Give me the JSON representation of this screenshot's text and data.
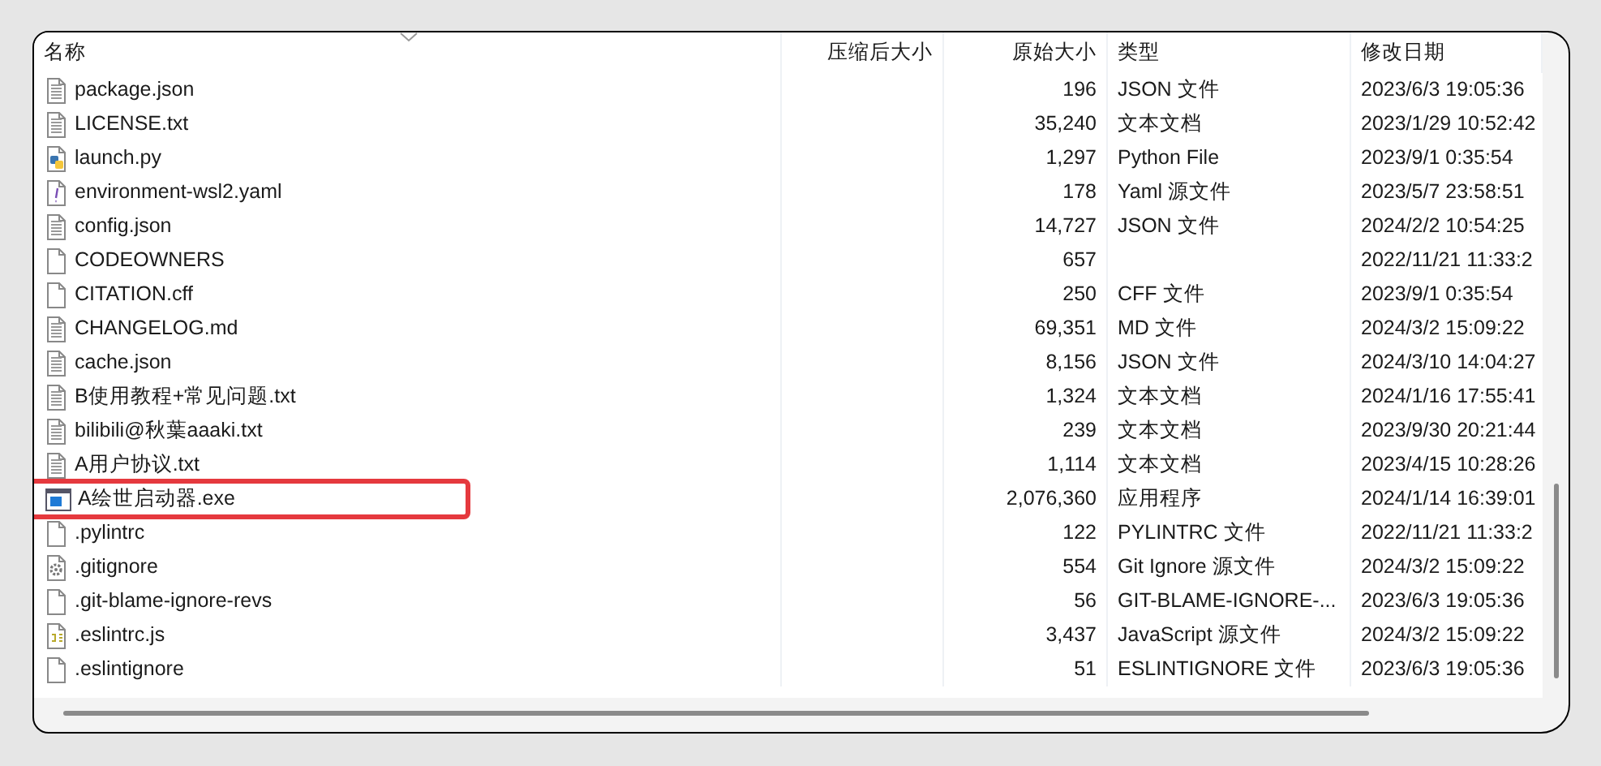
{
  "columns": [
    "名称",
    "压缩后大小",
    "原始大小",
    "类型",
    "修改日期"
  ],
  "rows": [
    {
      "name": "package.json",
      "kind": "text",
      "compressed": "",
      "size": "196",
      "type": "JSON 文件",
      "date": "2023/6/3 19:05:36",
      "highlighted": false
    },
    {
      "name": "LICENSE.txt",
      "kind": "text",
      "compressed": "",
      "size": "35,240",
      "type": "文本文档",
      "date": "2023/1/29 10:52:42",
      "highlighted": false
    },
    {
      "name": "launch.py",
      "kind": "python",
      "compressed": "",
      "size": "1,297",
      "type": "Python File",
      "date": "2023/9/1 0:35:54",
      "highlighted": false
    },
    {
      "name": "environment-wsl2.yaml",
      "kind": "yaml",
      "compressed": "",
      "size": "178",
      "type": "Yaml 源文件",
      "date": "2023/5/7 23:58:51",
      "highlighted": false
    },
    {
      "name": "config.json",
      "kind": "text",
      "compressed": "",
      "size": "14,727",
      "type": "JSON 文件",
      "date": "2024/2/2 10:54:25",
      "highlighted": false
    },
    {
      "name": "CODEOWNERS",
      "kind": "blank",
      "compressed": "",
      "size": "657",
      "type": "",
      "date": "2022/11/21 11:33:2",
      "highlighted": false
    },
    {
      "name": "CITATION.cff",
      "kind": "blank",
      "compressed": "",
      "size": "250",
      "type": "CFF 文件",
      "date": "2023/9/1 0:35:54",
      "highlighted": false
    },
    {
      "name": "CHANGELOG.md",
      "kind": "text",
      "compressed": "",
      "size": "69,351",
      "type": "MD 文件",
      "date": "2024/3/2 15:09:22",
      "highlighted": false
    },
    {
      "name": "cache.json",
      "kind": "text",
      "compressed": "",
      "size": "8,156",
      "type": "JSON 文件",
      "date": "2024/3/10 14:04:27",
      "highlighted": false
    },
    {
      "name": "B使用教程+常见问题.txt",
      "kind": "text",
      "compressed": "",
      "size": "1,324",
      "type": "文本文档",
      "date": "2024/1/16 17:55:41",
      "highlighted": false
    },
    {
      "name": "bilibili@秋葉aaaki.txt",
      "kind": "text",
      "compressed": "",
      "size": "239",
      "type": "文本文档",
      "date": "2023/9/30 20:21:44",
      "highlighted": false
    },
    {
      "name": "A用户协议.txt",
      "kind": "text",
      "compressed": "",
      "size": "1,114",
      "type": "文本文档",
      "date": "2023/4/15 10:28:26",
      "highlighted": false
    },
    {
      "name": "A绘世启动器.exe",
      "kind": "exe",
      "compressed": "",
      "size": "2,076,360",
      "type": "应用程序",
      "date": "2024/1/14 16:39:01",
      "highlighted": true
    },
    {
      "name": ".pylintrc",
      "kind": "blank",
      "compressed": "",
      "size": "122",
      "type": "PYLINTRC 文件",
      "date": "2022/11/21 11:33:2",
      "highlighted": false
    },
    {
      "name": ".gitignore",
      "kind": "gear",
      "compressed": "",
      "size": "554",
      "type": "Git Ignore 源文件",
      "date": "2024/3/2 15:09:22",
      "highlighted": false
    },
    {
      "name": ".git-blame-ignore-revs",
      "kind": "blank",
      "compressed": "",
      "size": "56",
      "type": "GIT-BLAME-IGNORE-...",
      "date": "2023/6/3 19:05:36",
      "highlighted": false
    },
    {
      "name": ".eslintrc.js",
      "kind": "js",
      "compressed": "",
      "size": "3,437",
      "type": "JavaScript 源文件",
      "date": "2024/3/2 15:09:22",
      "highlighted": false
    },
    {
      "name": ".eslintignore",
      "kind": "blank",
      "compressed": "",
      "size": "51",
      "type": "ESLINTIGNORE 文件",
      "date": "2023/6/3 19:05:36",
      "highlighted": false
    }
  ]
}
